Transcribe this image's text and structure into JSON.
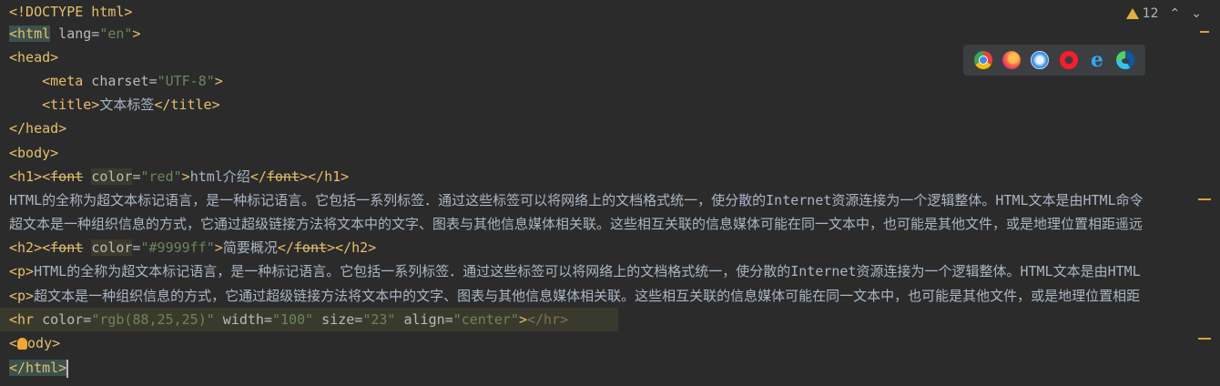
{
  "inspection": {
    "warning_count": "12",
    "up_label": "^",
    "down_label": "v"
  },
  "browsers": [
    "chrome",
    "firefox",
    "safari",
    "opera",
    "internet-explorer",
    "edge"
  ],
  "code": {
    "l1": "<!DOCTYPE html>",
    "l2_open": "<html",
    "l2_attr": " lang=",
    "l2_val": "\"en\"",
    "l2_close": ">",
    "l3": "<head>",
    "l4_indent": "    ",
    "l4_open": "<meta",
    "l4_attr": " charset=",
    "l4_val": "\"UTF-8\"",
    "l4_close": ">",
    "l5_open": "<title>",
    "l5_text": "文本标签",
    "l5_close": "</title>",
    "l6": "</head>",
    "l7": "<body>",
    "l8_h1": "<h1>",
    "l8_lt": "<",
    "l8_font": "font",
    "l8_sp": " ",
    "l8_color": "color",
    "l8_eq": "=",
    "l8_val": "\"red\"",
    "l8_gt": ">",
    "l8_text": "html介绍",
    "l8_close1": "</",
    "l8_font2": "font",
    "l8_close2": ">",
    "l8_close3": "</h1>",
    "l9": "HTML的全称为超文本标记语言，是一种标记语言。它包括一系列标签．通过这些标签可以将网络上的文档格式统一，使分散的Internet资源连接为一个逻辑整体。HTML文本是由HTML命令",
    "l10": "超文本是一种组织信息的方式，它通过超级链接方法将文本中的文字、图表与其他信息媒体相关联。这些相互关联的信息媒体可能在同一文本中，也可能是其他文件，或是地理位置相距遥远",
    "l11_h2": "<h2>",
    "l11_lt": "<",
    "l11_font": "font",
    "l11_sp": " ",
    "l11_color": "color",
    "l11_eq": "=",
    "l11_val": "\"#9999ff\"",
    "l11_gt": ">",
    "l11_text": "简要概况",
    "l11_close1": "</",
    "l11_font2": "font",
    "l11_close2": ">",
    "l11_close3": "</h2>",
    "l12_p": "<p>",
    "l12_text": "HTML的全称为超文本标记语言，是一种标记语言。它包括一系列标签．通过这些标签可以将网络上的文档格式统一，使分散的Internet资源连接为一个逻辑整体。HTML文本是由HTML",
    "l13_p": "<p>",
    "l13_text": "超文本是一种组织信息的方式，它通过超级链接方法将文本中的文字、图表与其他信息媒体相关联。这些相互关联的信息媒体可能在同一文本中，也可能是其他文件，或是地理位置相距",
    "l14_open": "<hr",
    "l14_a1": " color=",
    "l14_v1": "\"rgb(88,25,25)\"",
    "l14_a2": " width=",
    "l14_v2": "\"100\"",
    "l14_a3": " size=",
    "l14_v3": "\"23\"",
    "l14_a4": " align=",
    "l14_v4": "\"center\"",
    "l14_gt": ">",
    "l14_close": "</hr>",
    "l15_lt": "<",
    "l15_rest": "ody>",
    "l16": "</html>"
  }
}
